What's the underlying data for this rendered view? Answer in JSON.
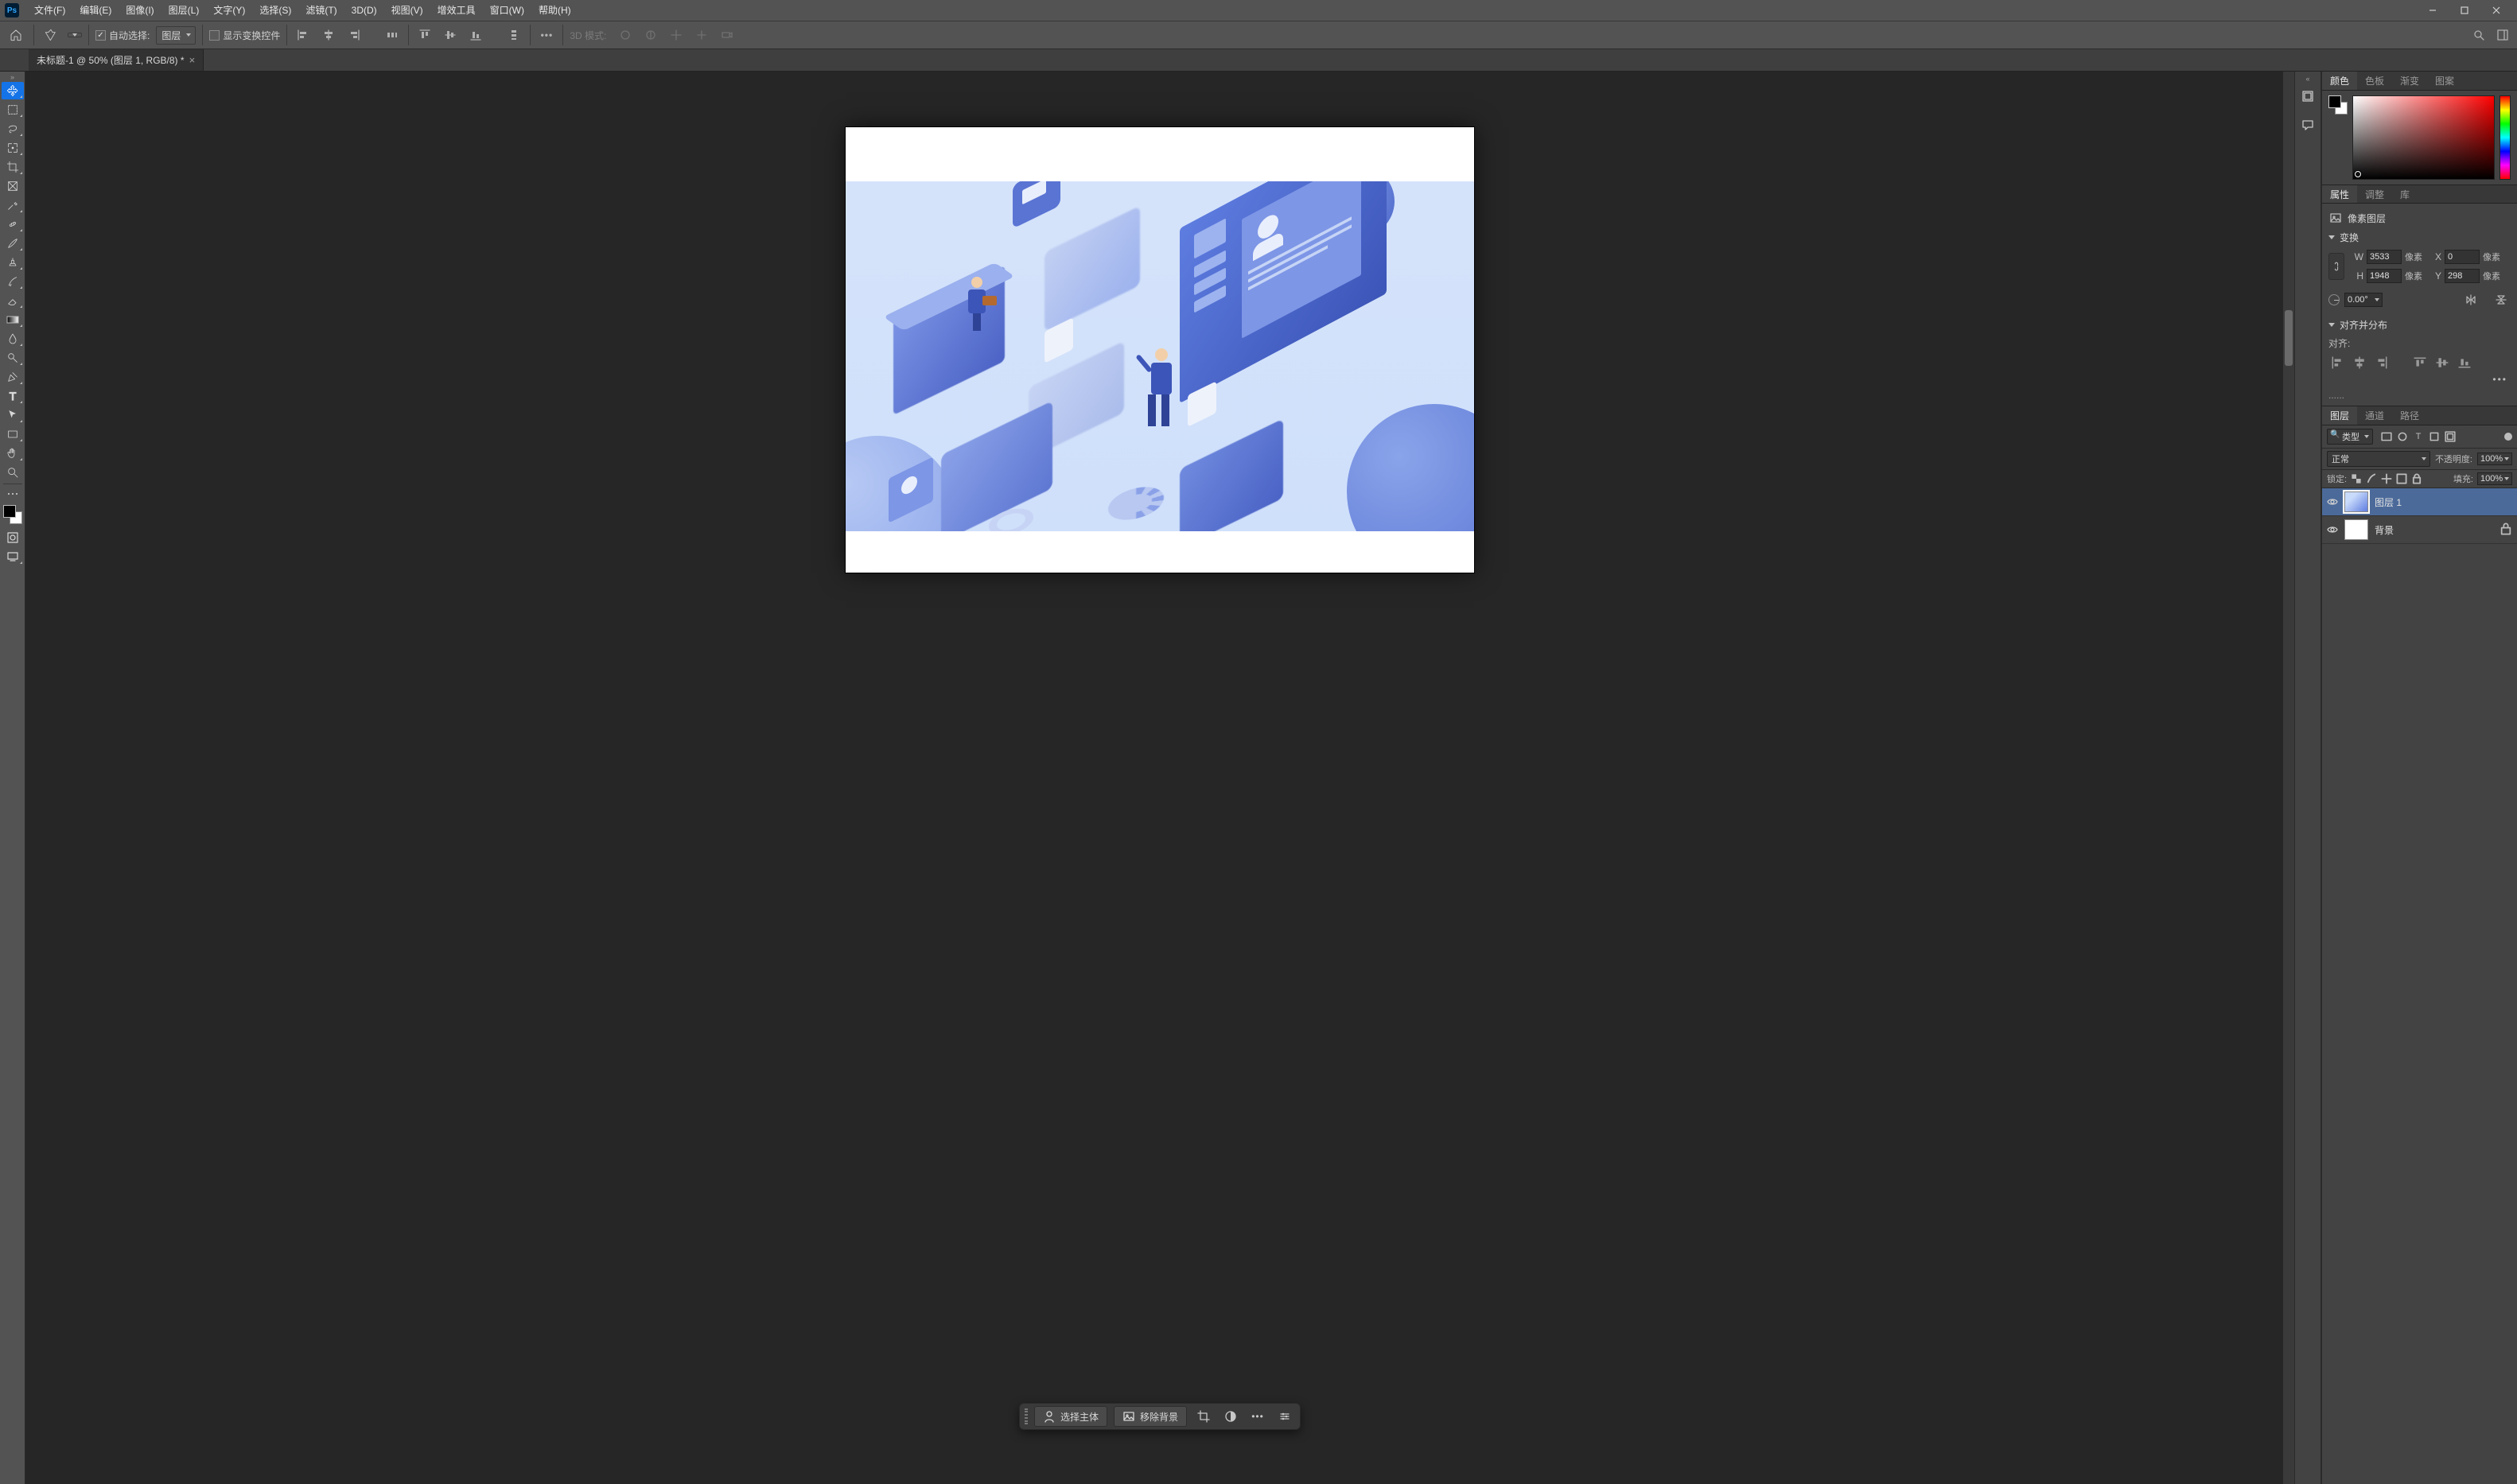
{
  "menubar": {
    "items": [
      "文件(F)",
      "编辑(E)",
      "图像(I)",
      "图层(L)",
      "文字(Y)",
      "选择(S)",
      "滤镜(T)",
      "3D(D)",
      "视图(V)",
      "增效工具",
      "窗口(W)",
      "帮助(H)"
    ]
  },
  "optbar": {
    "auto_select_label": "自动选择:",
    "auto_select_target": "图层",
    "show_transform_label": "显示变换控件",
    "mode3d_label": "3D 模式:"
  },
  "doc_tab": {
    "title": "未标题-1 @ 50% (图层 1, RGB/8) *"
  },
  "ctxbar": {
    "select_subject": "选择主体",
    "remove_bg": "移除背景"
  },
  "panels": {
    "color_tabs": [
      "颜色",
      "色板",
      "渐变",
      "图案"
    ],
    "props_tabs": [
      "属性",
      "调整",
      "库"
    ],
    "props": {
      "kind": "像素图层",
      "transform_label": "变换",
      "W": "3533",
      "H": "1948",
      "X": "0",
      "Y": "298",
      "unit": "像素",
      "angle": "0.00°",
      "alignsection": "对齐并分布",
      "align_label": "对齐:",
      "trunc": "......"
    },
    "layers_tabs": [
      "图层",
      "通道",
      "路径"
    ],
    "layers": {
      "filter_kind": "类型",
      "blend_mode": "正常",
      "opacity_label": "不透明度:",
      "opacity_val": "100%",
      "lock_label": "锁定:",
      "fill_label": "填充:",
      "fill_val": "100%",
      "items": [
        {
          "name": "图层 1",
          "locked": false,
          "selected": true,
          "thumb": "art"
        },
        {
          "name": "背景",
          "locked": true,
          "selected": false,
          "thumb": "white"
        }
      ]
    }
  }
}
